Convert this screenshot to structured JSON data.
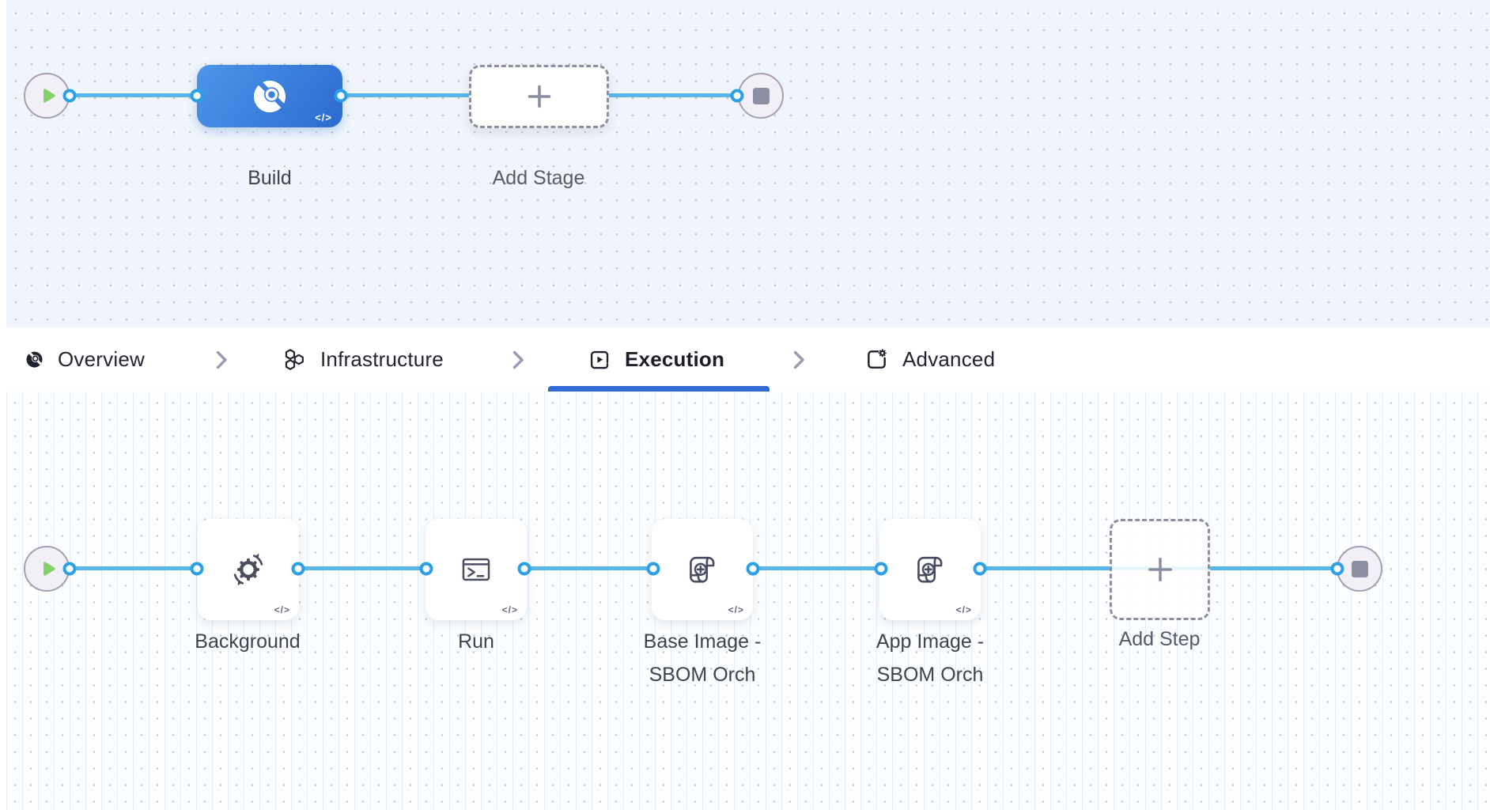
{
  "stage_pipeline": {
    "stages": [
      {
        "name": "Build",
        "type": "ci-build-stage"
      }
    ],
    "add_stage_label": "Add Stage",
    "code_badge": "</>"
  },
  "tab_bar": {
    "tabs": [
      {
        "label": "Overview",
        "icon": "ci-pie-icon",
        "active": false
      },
      {
        "label": "Infrastructure",
        "icon": "hexagons-icon",
        "active": false
      },
      {
        "label": "Execution",
        "icon": "play-box-icon",
        "active": true
      },
      {
        "label": "Advanced",
        "icon": "box-gear-icon",
        "active": false
      }
    ]
  },
  "execution_pipeline": {
    "steps": [
      {
        "name": "Background",
        "icon": "sync-gear-icon",
        "label_lines": [
          "Background"
        ]
      },
      {
        "name": "Run",
        "icon": "terminal-icon",
        "label_lines": [
          "Run"
        ]
      },
      {
        "name": "Base Image - SBOM Orch",
        "icon": "scroll-plus-icon",
        "label_lines": [
          "Base Image -",
          "SBOM Orch"
        ]
      },
      {
        "name": "App Image - SBOM Orch",
        "icon": "scroll-plus-icon",
        "label_lines": [
          "App Image -",
          "SBOM Orch"
        ]
      }
    ],
    "add_step_label": "Add Step",
    "code_badge": "</>"
  },
  "colors": {
    "active_tab_underline": "#2f6bd3",
    "connector_line": "#58b6ea",
    "connector_port_border": "#2ba0e6",
    "stage_gradient_start": "#4c96e8",
    "stage_gradient_end": "#2c6ad0",
    "start_play_green": "#86d069",
    "stop_square_gray": "#8d8fa2",
    "canvas_top_bg": "#eff5fa",
    "canvas_bottom_bg": "#fbfdfe"
  }
}
